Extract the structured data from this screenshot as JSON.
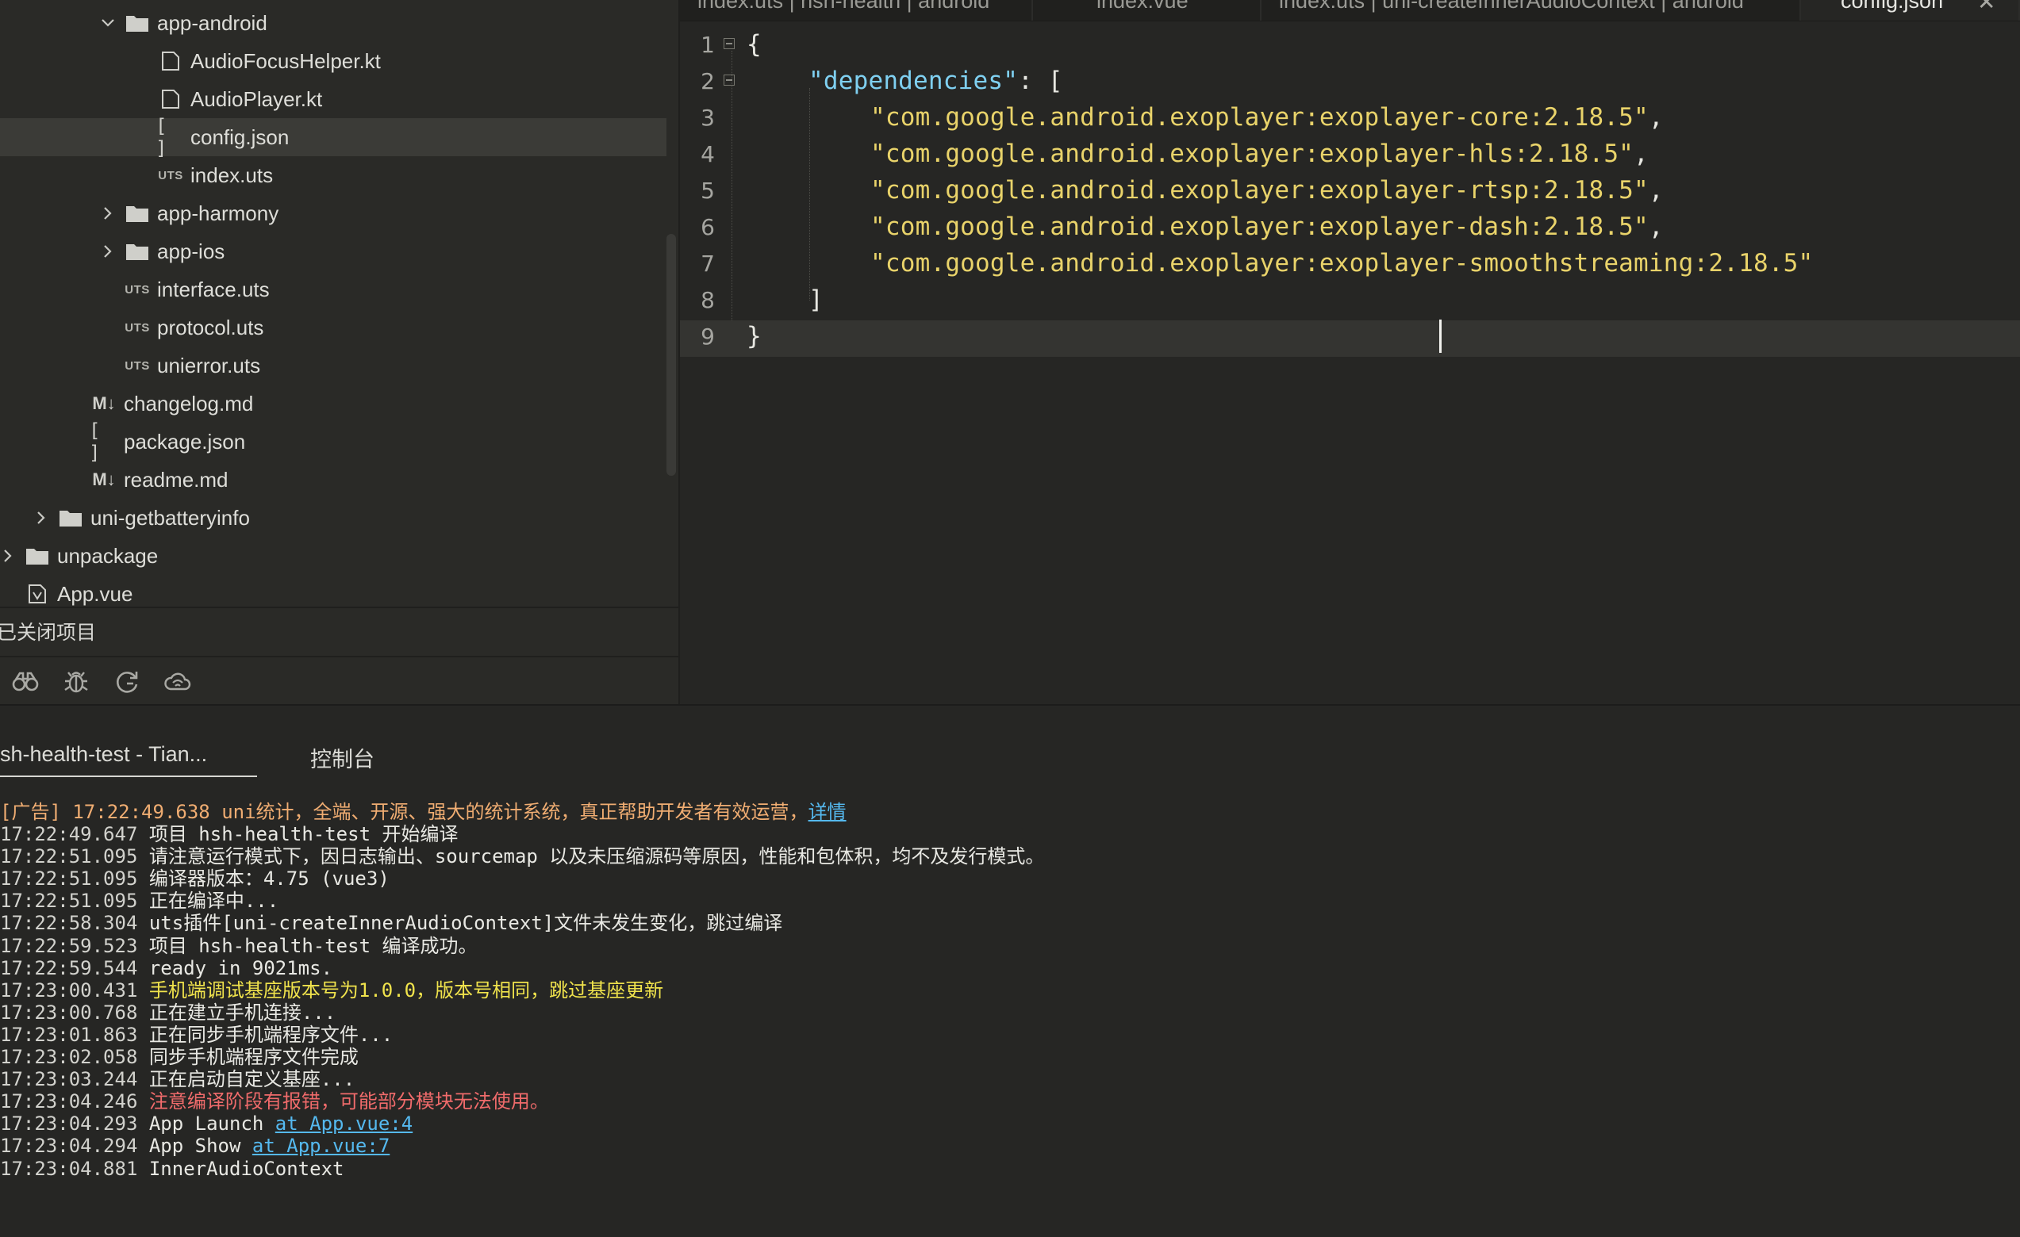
{
  "sidebar": {
    "tree": [
      {
        "label": "app-android",
        "type": "folder",
        "expanded": true
      },
      {
        "label": "AudioFocusHelper.kt",
        "type": "file"
      },
      {
        "label": "AudioPlayer.kt",
        "type": "file"
      },
      {
        "label": "config.json",
        "type": "json",
        "selected": true
      },
      {
        "label": "index.uts",
        "type": "uts"
      },
      {
        "label": "app-harmony",
        "type": "folder",
        "expanded": false
      },
      {
        "label": "app-ios",
        "type": "folder",
        "expanded": false
      },
      {
        "label": "interface.uts",
        "type": "uts"
      },
      {
        "label": "protocol.uts",
        "type": "uts"
      },
      {
        "label": "unierror.uts",
        "type": "uts"
      },
      {
        "label": "changelog.md",
        "type": "md"
      },
      {
        "label": "package.json",
        "type": "json"
      },
      {
        "label": "readme.md",
        "type": "md"
      },
      {
        "label": "uni-getbatteryinfo",
        "type": "folder",
        "expanded": false
      },
      {
        "label": "unpackage",
        "type": "folder",
        "expanded": false
      },
      {
        "label": "App.vue",
        "type": "vue"
      }
    ],
    "uts_badge": "UTS",
    "json_badge": "[ ]",
    "md_badge": "M↓",
    "closed_projects": "已关闭项目",
    "tools": [
      "binoculars-icon",
      "bug-icon",
      "refresh-g-icon",
      "cloud-icon"
    ]
  },
  "editor": {
    "tabs": [
      {
        "label": "index.uts | hsh-health | android",
        "active": false
      },
      {
        "label": "index.vue",
        "active": false
      },
      {
        "label": "index.uts | uni-createInnerAudioContext | android",
        "active": false
      },
      {
        "label": "config.json",
        "active": true
      }
    ],
    "tab_close": "✕",
    "lines": [
      {
        "n": "1",
        "tokens": [
          {
            "t": "{",
            "c": "punc"
          }
        ],
        "fold": true
      },
      {
        "n": "2",
        "tokens": [
          {
            "t": "\"dependencies\"",
            "c": "key"
          },
          {
            "t": ": [",
            "c": "punc"
          }
        ],
        "fold": true
      },
      {
        "n": "3",
        "tokens": [
          {
            "t": "\"com.google.android.exoplayer:exoplayer-core:2.18.5\"",
            "c": "str"
          },
          {
            "t": ",",
            "c": "punc"
          }
        ]
      },
      {
        "n": "4",
        "tokens": [
          {
            "t": "\"com.google.android.exoplayer:exoplayer-hls:2.18.5\"",
            "c": "str"
          },
          {
            "t": ",",
            "c": "punc"
          }
        ]
      },
      {
        "n": "5",
        "tokens": [
          {
            "t": "\"com.google.android.exoplayer:exoplayer-rtsp:2.18.5\"",
            "c": "str"
          },
          {
            "t": ",",
            "c": "punc"
          }
        ]
      },
      {
        "n": "6",
        "tokens": [
          {
            "t": "\"com.google.android.exoplayer:exoplayer-dash:2.18.5\"",
            "c": "str"
          },
          {
            "t": ",",
            "c": "punc"
          }
        ]
      },
      {
        "n": "7",
        "tokens": [
          {
            "t": "\"com.google.android.exoplayer:exoplayer-smoothstreaming:2.18.5\"",
            "c": "str"
          }
        ]
      },
      {
        "n": "8",
        "tokens": [
          {
            "t": "]",
            "c": "punc"
          }
        ]
      },
      {
        "n": "9",
        "tokens": [
          {
            "t": "}",
            "c": "punc"
          }
        ],
        "current": true
      }
    ]
  },
  "panel": {
    "tabs": [
      {
        "label": "sh-health-test - Tian...",
        "active": true
      },
      {
        "label": "控制台",
        "active": false
      }
    ],
    "logs": [
      {
        "ts": "[广告] 17:22:49.638",
        "msg": "uni统计，全端、开源、强大的统计系统，真正帮助开发者有效运营，",
        "link": "详情",
        "kind": "ad"
      },
      {
        "ts": "17:22:49.647",
        "msg": "项目 hsh-health-test 开始编译"
      },
      {
        "ts": "17:22:51.095",
        "msg": "请注意运行模式下，因日志输出、sourcemap 以及未压缩源码等原因，性能和包体积，均不及发行模式。"
      },
      {
        "ts": "17:22:51.095",
        "msg": "编译器版本：4.75 (vue3)"
      },
      {
        "ts": "17:22:51.095",
        "msg": "正在编译中..."
      },
      {
        "ts": "17:22:58.304",
        "msg": "uts插件[uni-createInnerAudioContext]文件未发生变化，跳过编译"
      },
      {
        "ts": "17:22:59.523",
        "msg": "项目 hsh-health-test 编译成功。"
      },
      {
        "ts": "17:22:59.544",
        "msg": "ready in 9021ms."
      },
      {
        "ts": "17:23:00.431",
        "msg": "手机端调试基座版本号为1.0.0，版本号相同，跳过基座更新",
        "kind": "warn"
      },
      {
        "ts": "17:23:00.768",
        "msg": "正在建立手机连接..."
      },
      {
        "ts": "17:23:01.863",
        "msg": "正在同步手机端程序文件..."
      },
      {
        "ts": "17:23:02.058",
        "msg": "同步手机端程序文件完成"
      },
      {
        "ts": "17:23:03.244",
        "msg": "正在启动自定义基座..."
      },
      {
        "ts": "17:23:04.246",
        "msg": "注意编译阶段有报错，可能部分模块无法使用。",
        "kind": "error"
      },
      {
        "ts": "17:23:04.293",
        "msg": "App Launch ",
        "link": "at App.vue:4"
      },
      {
        "ts": "17:23:04.294",
        "msg": "App Show ",
        "link": "at App.vue:7"
      },
      {
        "ts": "17:23:04.881",
        "msg": "InnerAudioContext"
      }
    ]
  }
}
